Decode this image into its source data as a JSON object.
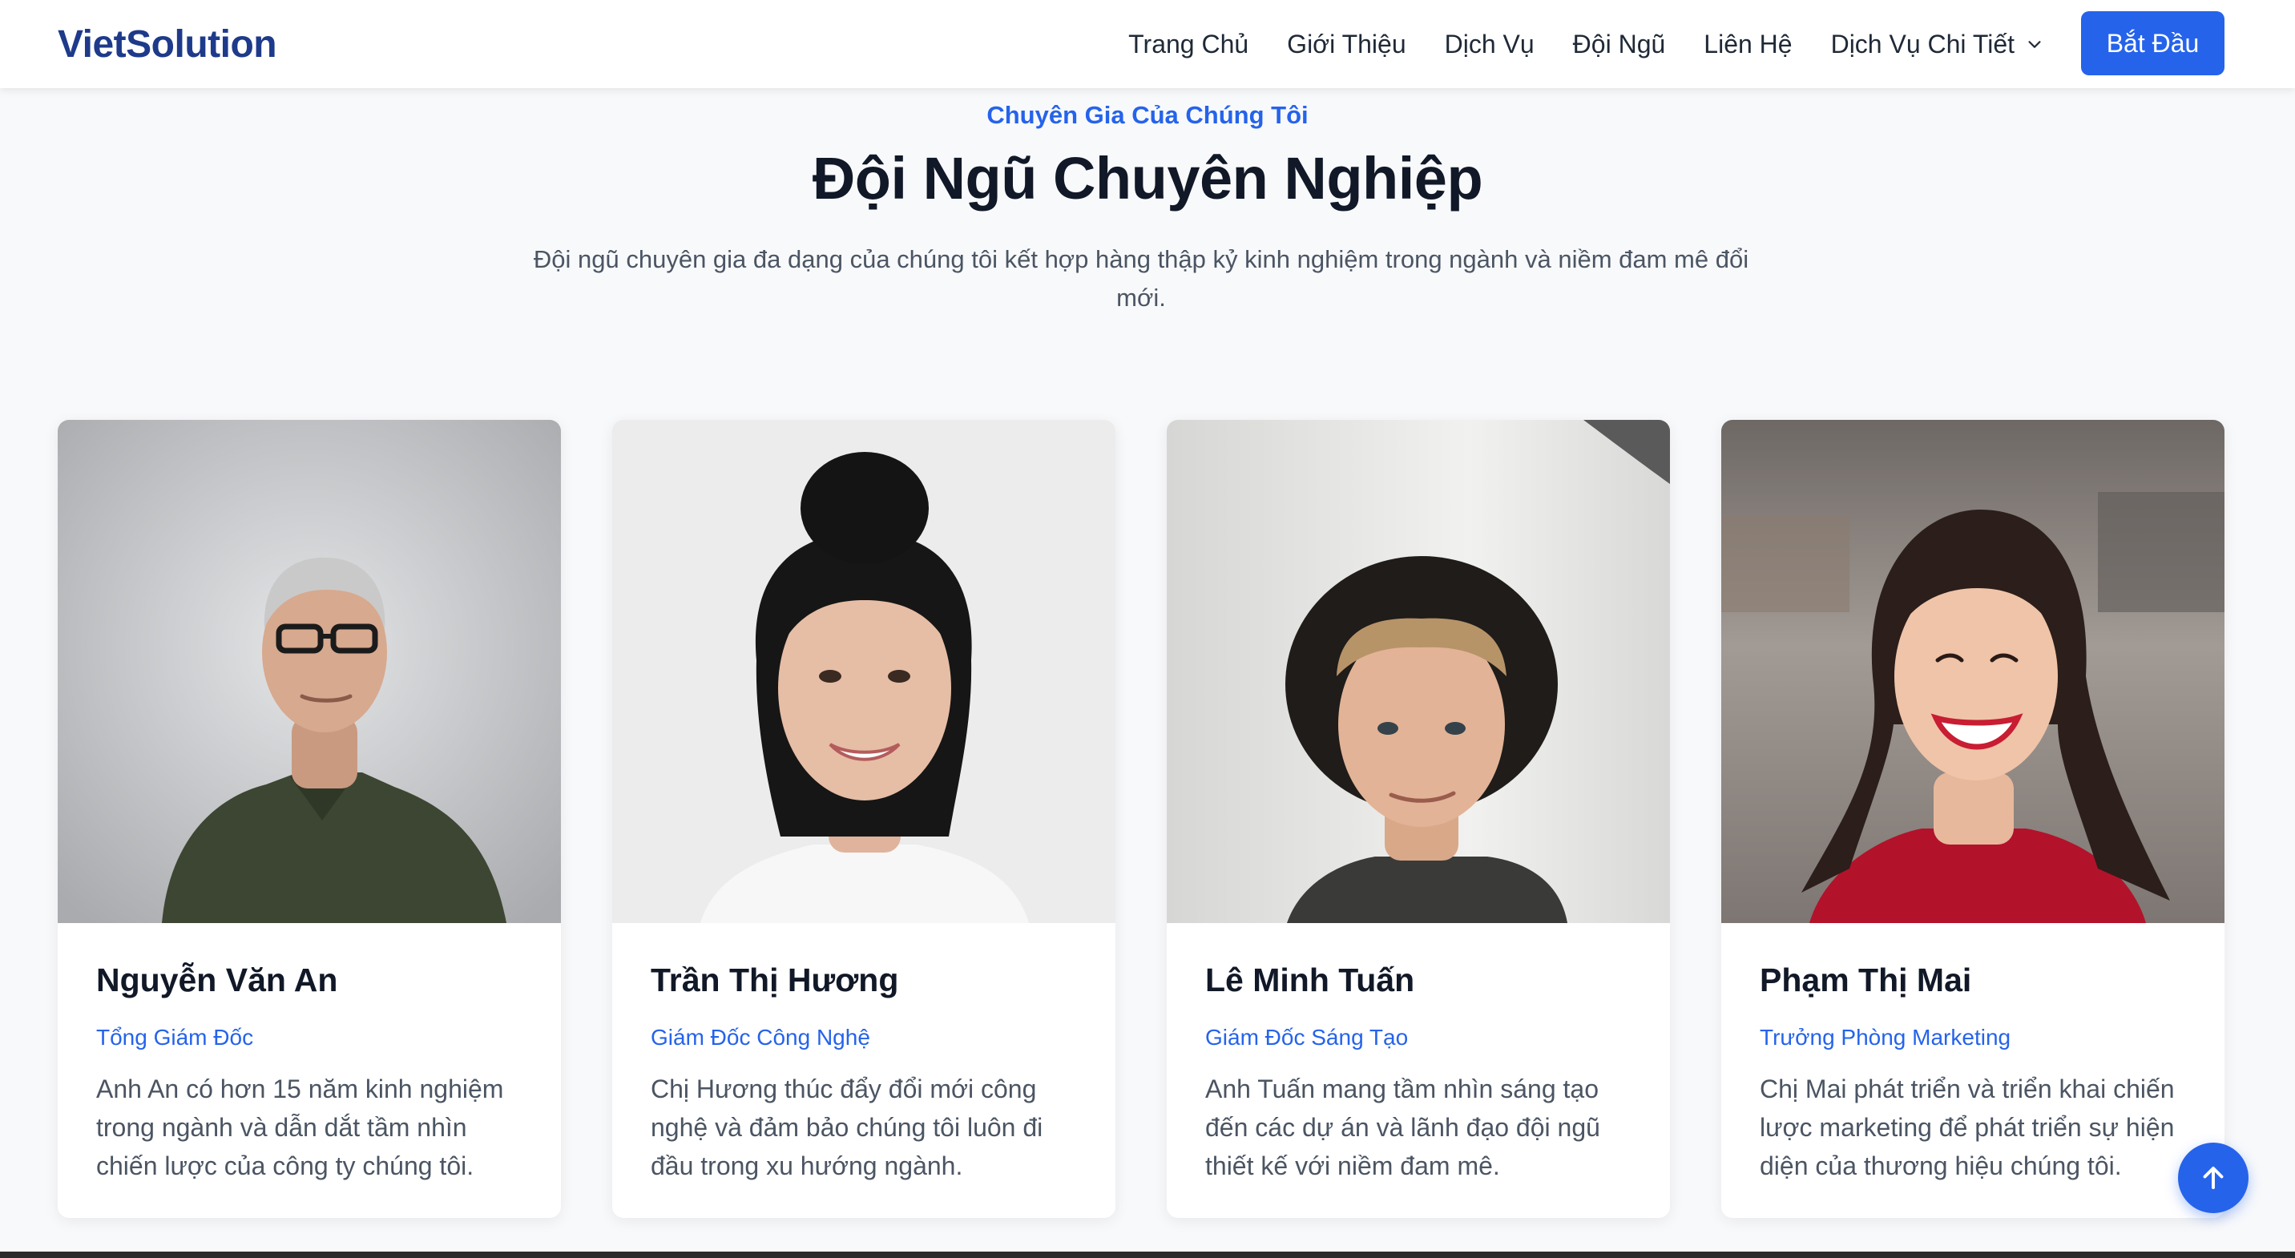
{
  "brand": {
    "logo": "VietSolution"
  },
  "nav": {
    "links": [
      "Trang Chủ",
      "Giới Thiệu",
      "Dịch Vụ",
      "Đội Ngũ",
      "Liên Hệ"
    ],
    "dropdown_label": "Dịch Vụ Chi Tiết",
    "cta_label": "Bắt Đầu"
  },
  "team_section": {
    "eyebrow": "Chuyên Gia Của Chúng Tôi",
    "title": "Đội Ngũ Chuyên Nghiệp",
    "description": "Đội ngũ chuyên gia đa dạng của chúng tôi kết hợp hàng thập kỷ kinh nghiệm trong ngành và niềm đam mê đổi mới."
  },
  "members": [
    {
      "name": "Nguyễn Văn An",
      "role": "Tổng Giám Đốc",
      "bio": "Anh An có hơn 15 năm kinh nghiệm trong ngành và dẫn dắt tầm nhìn chiến lược của công ty chúng tôi."
    },
    {
      "name": "Trần Thị Hương",
      "role": "Giám Đốc Công Nghệ",
      "bio": "Chị Hương thúc đẩy đổi mới công nghệ và đảm bảo chúng tôi luôn đi đầu trong xu hướng ngành."
    },
    {
      "name": "Lê Minh Tuấn",
      "role": "Giám Đốc Sáng Tạo",
      "bio": "Anh Tuấn mang tầm nhìn sáng tạo đến các dự án và lãnh đạo đội ngũ thiết kế với niềm đam mê."
    },
    {
      "name": "Phạm Thị Mai",
      "role": "Trưởng Phòng Marketing",
      "bio": "Chị Mai phát triển và triển khai chiến lược marketing để phát triển sự hiện diện của thương hiệu chúng tôi."
    }
  ],
  "icons": {
    "dropdown": "chevron-down-icon",
    "scroll_top": "arrow-up-icon"
  },
  "colors": {
    "accent": "#2563eb",
    "brand": "#1e3a8a",
    "heading": "#111827",
    "body_text": "#4b5563"
  }
}
